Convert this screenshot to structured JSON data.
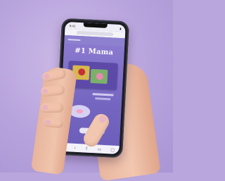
{
  "scene": {
    "background_color": "#b9a6dc",
    "phone": {
      "screen": {
        "headline": "#1 Mama",
        "status_time": "9:41",
        "bottom_icons": [
          "back-icon",
          "forward-icon",
          "share-icon",
          "bookmarks-icon",
          "tabs-icon"
        ],
        "accent_color": "#7a6ec2"
      }
    }
  }
}
